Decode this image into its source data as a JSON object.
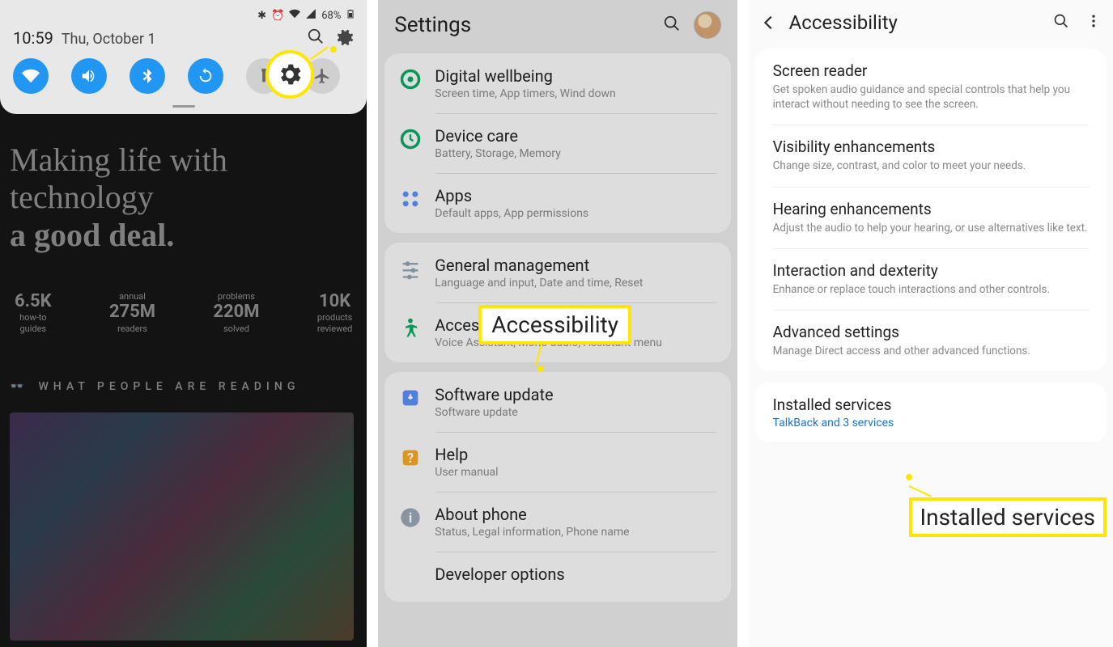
{
  "panel1": {
    "statusbar": {
      "battery_pct": "68%"
    },
    "time": "10:59",
    "date": "Thu, October 1",
    "tiles": [
      {
        "name": "wifi-icon",
        "on": true
      },
      {
        "name": "volume-icon",
        "on": true
      },
      {
        "name": "bluetooth-icon",
        "on": true
      },
      {
        "name": "sync-icon",
        "on": true
      },
      {
        "name": "flashlight-icon",
        "on": false
      },
      {
        "name": "airplane-icon",
        "on": false
      }
    ],
    "headline_l1": "Making life with technology",
    "headline_l2": "a good deal.",
    "stats": [
      {
        "big": "6.5K",
        "l1": "how-to",
        "l2": "guides"
      },
      {
        "big": "275M",
        "l1": "annual",
        "l2": "readers"
      },
      {
        "big": "220M",
        "l1": "problems",
        "l2": "solved"
      },
      {
        "big": "10K",
        "l1": "products",
        "l2": "reviewed"
      }
    ],
    "reading_label": "WHAT PEOPLE ARE READING"
  },
  "panel2": {
    "title": "Settings",
    "groups": [
      [
        {
          "icon": "wellbeing-icon",
          "color": "#0ba863",
          "title": "Digital wellbeing",
          "sub": "Screen time, App timers, Wind down"
        },
        {
          "icon": "devicecare-icon",
          "color": "#0ba863",
          "title": "Device care",
          "sub": "Battery, Storage, Memory"
        },
        {
          "icon": "apps-icon",
          "color": "#5b8ff5",
          "title": "Apps",
          "sub": "Default apps, App permissions"
        }
      ],
      [
        {
          "icon": "sliders-icon",
          "color": "#8fa3b5",
          "title": "General management",
          "sub": "Language and input, Date and time, Reset"
        },
        {
          "icon": "accessibility-icon",
          "color": "#0ba863",
          "title": "Accessibility",
          "sub": "Voice Assistant, Mono audio, Assistant menu"
        }
      ],
      [
        {
          "icon": "update-icon",
          "color": "#5b8ff5",
          "title": "Software update",
          "sub": "Software update"
        },
        {
          "icon": "help-icon",
          "color": "#f5a623",
          "title": "Help",
          "sub": "User manual"
        },
        {
          "icon": "about-icon",
          "color": "#9aa5b1",
          "title": "About phone",
          "sub": "Status, Legal information, Phone name"
        },
        {
          "icon": "dev-icon",
          "color": "#9aa5b1",
          "title": "Developer options",
          "sub": ""
        }
      ]
    ],
    "callout": "Accessibility"
  },
  "panel3": {
    "title": "Accessibility",
    "groups": [
      [
        {
          "title": "Screen reader",
          "sub": "Get spoken audio guidance and special controls that help you interact without needing to see the screen."
        },
        {
          "title": "Visibility enhancements",
          "sub": "Change size, contrast, and color to meet your needs."
        },
        {
          "title": "Hearing enhancements",
          "sub": "Adjust the audio to help your hearing, or use alternatives like text."
        },
        {
          "title": "Interaction and dexterity",
          "sub": "Enhance or replace touch interactions and other controls."
        },
        {
          "title": "Advanced settings",
          "sub": "Manage Direct access and other advanced functions."
        }
      ],
      [
        {
          "title": "Installed services",
          "link": "TalkBack and 3 services"
        }
      ]
    ],
    "callout": "Installed services"
  }
}
